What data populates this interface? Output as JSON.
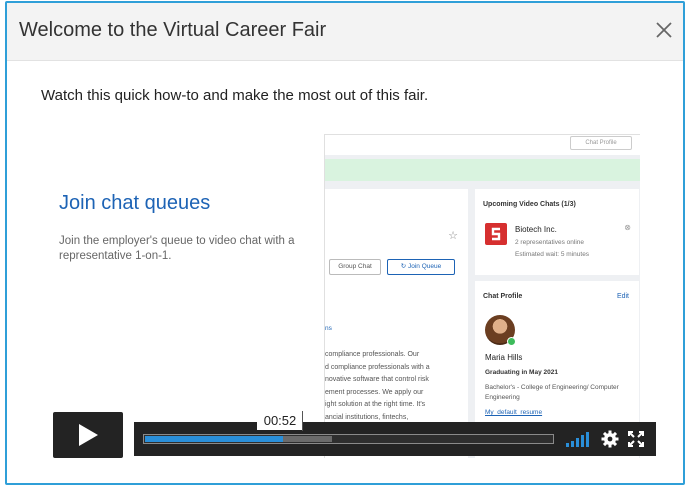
{
  "modal": {
    "title": "Welcome to the Virtual Career Fair",
    "intro": "Watch this quick how-to and make the most out of this fair."
  },
  "slide": {
    "heading": "Join chat queues",
    "description": "Join the employer's queue to video chat with a representative 1-on-1."
  },
  "app": {
    "chat_profile_pill": "Chat Profile",
    "buttons": {
      "group_chat": "Group Chat",
      "join_queue": "Join Queue"
    },
    "description_link": "ns",
    "description_body": "compliance professionals. Our\nd compliance professionals with a\nnovative software that control risk\nement processes. We apply our\night solution at the right time. It's\nancial institutions, fintechs,",
    "upcoming": {
      "title": "Upcoming Video Chats (1/3)",
      "company": "Biotech Inc.",
      "reps": "2 representatives online",
      "wait": "Estimated wait: 5 minutes"
    },
    "profile": {
      "title": "Chat Profile",
      "edit": "Edit",
      "name": "Maria Hills",
      "graduating": "Graduating in May 2021",
      "degree": "Bachelor's - College of Engineering/ Computer Engineering",
      "resume": "My_default_resume"
    }
  },
  "player": {
    "current_time": "00:52",
    "played_fraction": 0.34,
    "buffered_fraction": 0.46,
    "volume_level": 1.0
  },
  "colors": {
    "accent": "#2f9fd8",
    "progress": "#2a8fd9",
    "link": "#1d63b5",
    "bar_bg": "#232323"
  },
  "icons": {
    "close": "close-icon",
    "play": "play-icon",
    "volume": "volume-icon",
    "settings": "gear-icon",
    "fullscreen": "fullscreen-icon"
  }
}
